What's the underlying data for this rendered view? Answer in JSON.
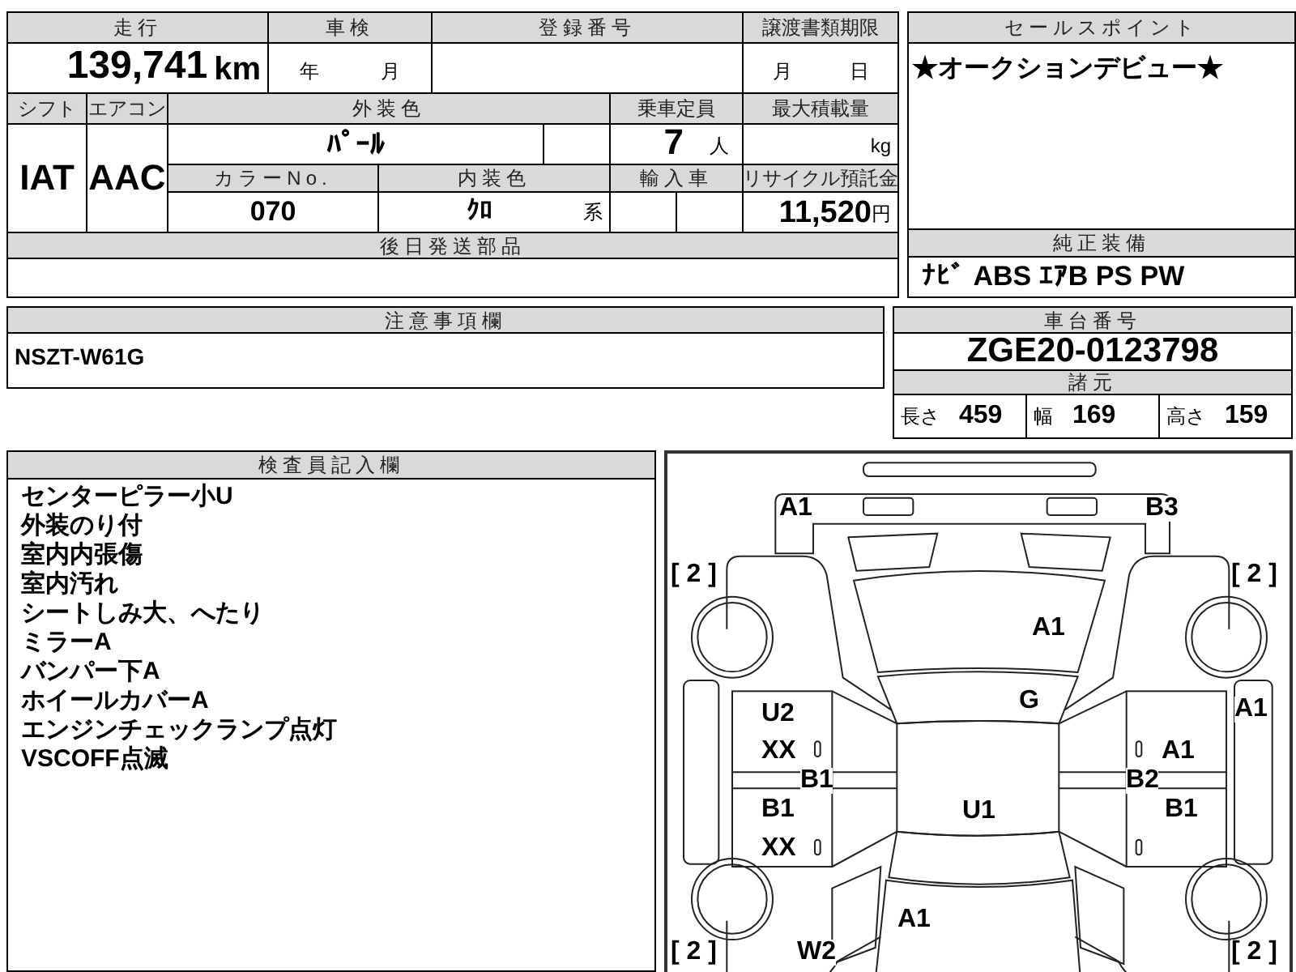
{
  "odometer": {
    "header": "走行",
    "value": "139,741",
    "unit": "km"
  },
  "inspection": {
    "header": "車検",
    "year_label": "年",
    "month_label": "月"
  },
  "registration": {
    "header": "登録番号"
  },
  "transfer_deadline": {
    "header": "譲渡書類期限",
    "month_label": "月",
    "day_label": "日"
  },
  "shift": {
    "header": "シフト",
    "value": "IAT"
  },
  "air_conditioner": {
    "header": "エアコン",
    "value": "AAC"
  },
  "exterior_color": {
    "header": "外装色",
    "value": "ﾊﾟｰﾙ"
  },
  "capacity": {
    "header": "乗車定員",
    "value": "7",
    "unit": "人"
  },
  "max_load": {
    "header": "最大積載量",
    "unit": "kg"
  },
  "color_no": {
    "header": "カラーNo.",
    "value": "070"
  },
  "interior_color": {
    "header": "内装色",
    "value": "ｸﾛ",
    "suffix": "系"
  },
  "imported": {
    "header": "輸入車"
  },
  "recycling_fee": {
    "header": "リサイクル預託金",
    "value": "11,520",
    "unit": "円"
  },
  "later_parts": {
    "header": "後日発送部品"
  },
  "sales_point": {
    "header": "セールスポイント",
    "text": "★オークションデビュー★"
  },
  "equipment": {
    "header": "純正装備",
    "text": "ﾅﾋﾞ ABS ｴｱB PS PW"
  },
  "notes": {
    "header": "注意事項欄",
    "text": "NSZT-W61G"
  },
  "chassis": {
    "header": "車台番号",
    "value": "ZGE20-0123798"
  },
  "specs": {
    "header": "諸元",
    "items": [
      {
        "label": "長さ",
        "value": "459"
      },
      {
        "label": "幅",
        "value": "169"
      },
      {
        "label": "高さ",
        "value": "159"
      }
    ]
  },
  "inspector": {
    "header": "検査員記入欄",
    "lines": [
      "センターピラー小U",
      "外装のり付",
      "室内内張傷",
      "室内汚れ",
      "シートしみ大、へたり",
      "ミラーA",
      "バンパー下A",
      "ホイールカバーA",
      "エンジンチェックランプ点灯",
      "VSCOFF点滅"
    ]
  },
  "diagram": {
    "marks": [
      "A1",
      "B3",
      "[ 2 ]",
      "[ 2 ]",
      "A1",
      "G",
      "U2",
      "XX",
      "B1",
      "B1",
      "XX",
      "U1",
      "A1",
      "A1",
      "B2",
      "B1",
      "A1",
      "[ 2 ]",
      "W2",
      "[ 2 ]"
    ]
  }
}
